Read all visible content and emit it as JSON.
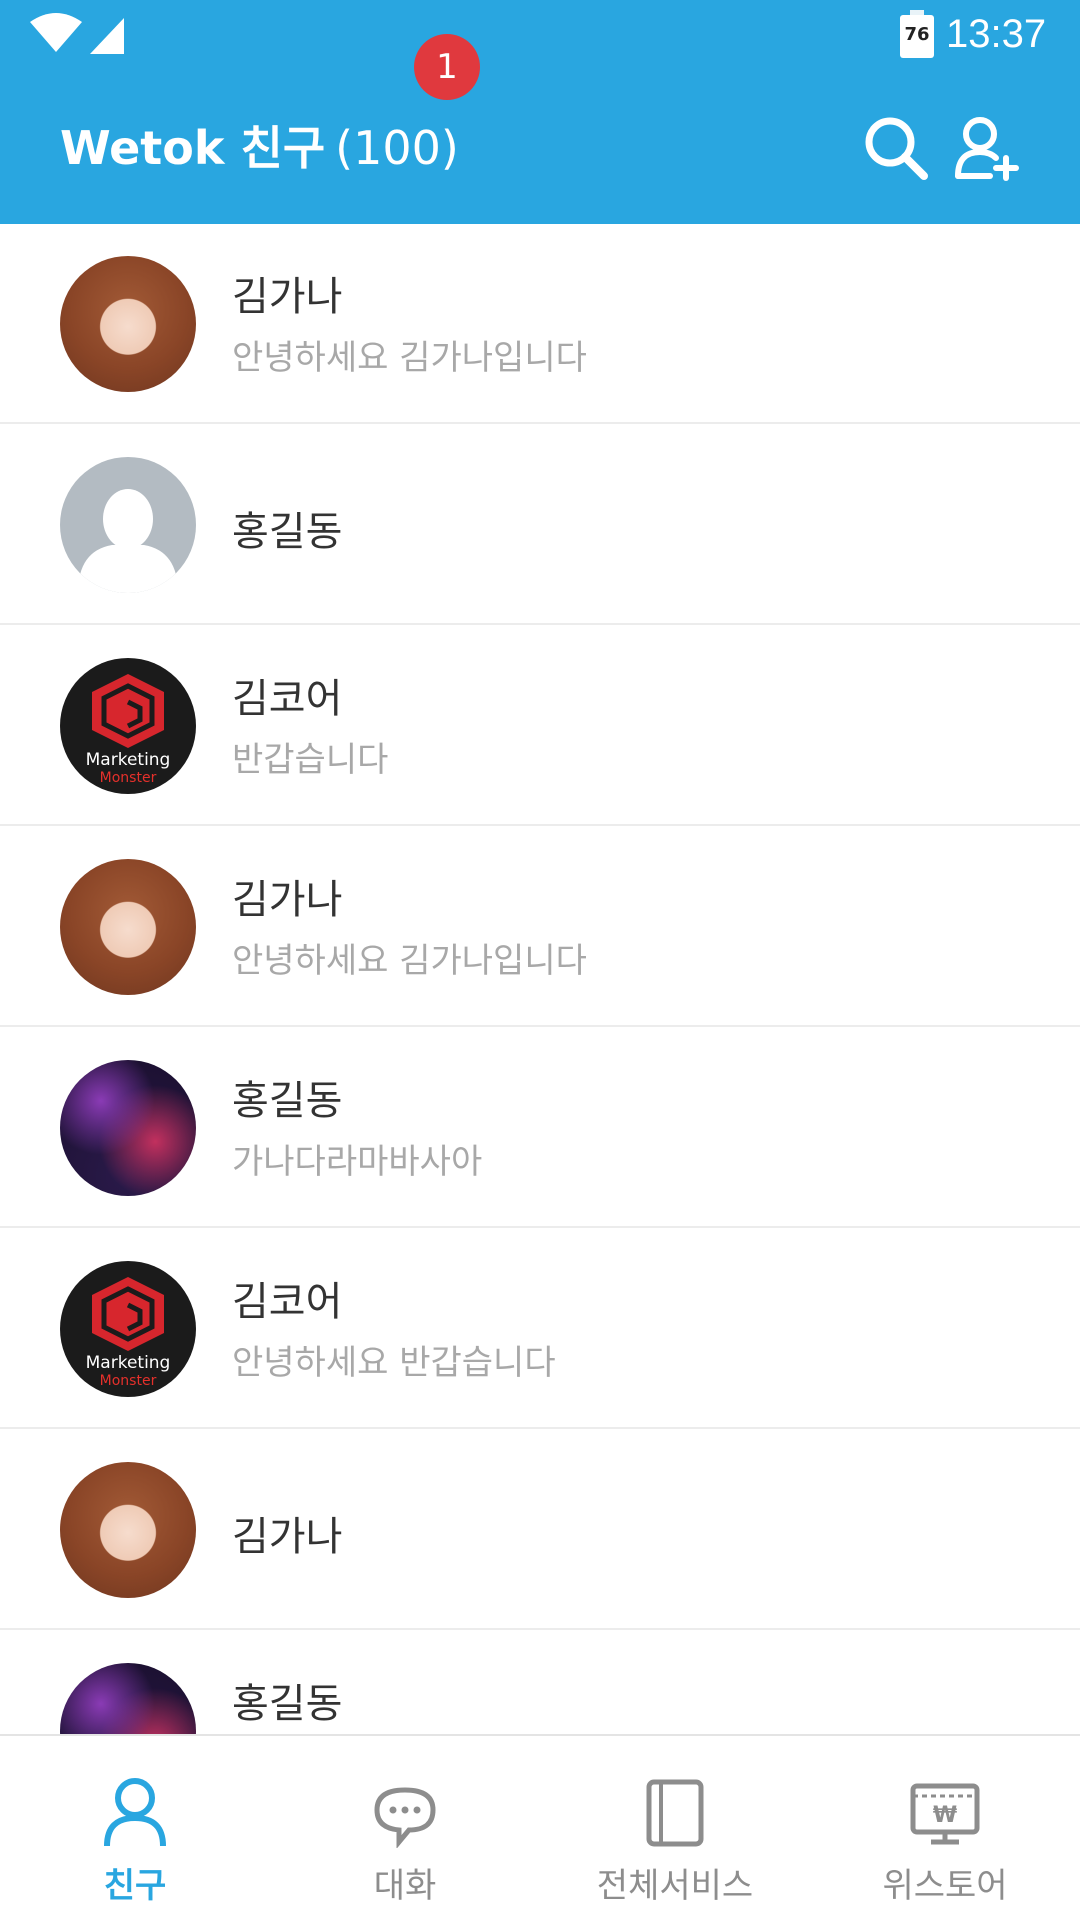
{
  "status_bar": {
    "battery": "76",
    "time": "13:37"
  },
  "header": {
    "title": "Wetok 친구",
    "count": "(100)"
  },
  "friends": [
    {
      "name": "김가나",
      "status": "안녕하세요 김가나입니다",
      "avatar": "woman-photo"
    },
    {
      "name": "홍길동",
      "status": "",
      "avatar": "default-person"
    },
    {
      "name": "김코어",
      "status": "반갑습니다",
      "avatar": "marketing-monster-logo"
    },
    {
      "name": "김가나",
      "status": "안녕하세요 김가나입니다",
      "avatar": "woman-photo"
    },
    {
      "name": "홍길동",
      "status": "가나다라마바사아",
      "avatar": "movie-poster"
    },
    {
      "name": "김코어",
      "status": "안녕하세요 반갑습니다",
      "avatar": "marketing-monster-logo"
    },
    {
      "name": "김가나",
      "status": "",
      "avatar": "woman-photo"
    },
    {
      "name": "홍길동",
      "status": "",
      "avatar": "movie-poster"
    }
  ],
  "logo": {
    "line1": "Marketing",
    "line2": "Monster"
  },
  "tabs": [
    {
      "label": "친구",
      "icon": "person-icon",
      "active": true
    },
    {
      "label": "대화",
      "icon": "chat-bubble-icon",
      "badge": "1"
    },
    {
      "label": "전체서비스",
      "icon": "book-icon"
    },
    {
      "label": "위스토어",
      "icon": "store-icon"
    }
  ],
  "colors": {
    "primary": "#29a6e0",
    "badge": "#e0393e"
  }
}
